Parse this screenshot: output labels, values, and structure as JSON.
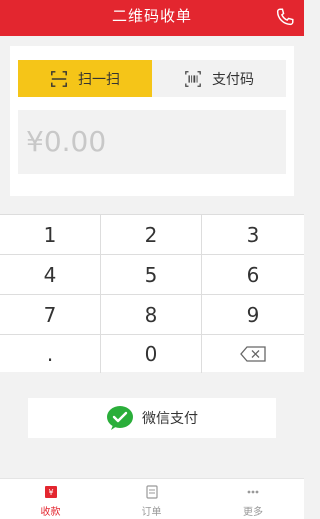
{
  "header": {
    "title": "二维码收单",
    "phone_icon": "phone-icon"
  },
  "tabs": [
    {
      "label": "扫一扫",
      "icon": "scan-icon"
    },
    {
      "label": "支付码",
      "icon": "barcode-icon"
    }
  ],
  "amount": {
    "value": "¥0.00"
  },
  "keypad": {
    "keys": [
      "1",
      "2",
      "3",
      "4",
      "5",
      "6",
      "7",
      "8",
      "9",
      ".",
      "0"
    ],
    "backspace_icon": "backspace-icon"
  },
  "payment": {
    "label": "微信支付",
    "icon": "wechat-icon"
  },
  "bottom_nav": {
    "items": [
      {
        "label": "收款",
        "icon": "cash-register-icon"
      },
      {
        "label": "订单",
        "icon": "order-icon"
      },
      {
        "label": "更多",
        "icon": "more-icon"
      }
    ]
  },
  "colors": {
    "primary_red": "#e3262f",
    "tab_yellow": "#f5c518",
    "wechat_green": "#2aae3a"
  }
}
